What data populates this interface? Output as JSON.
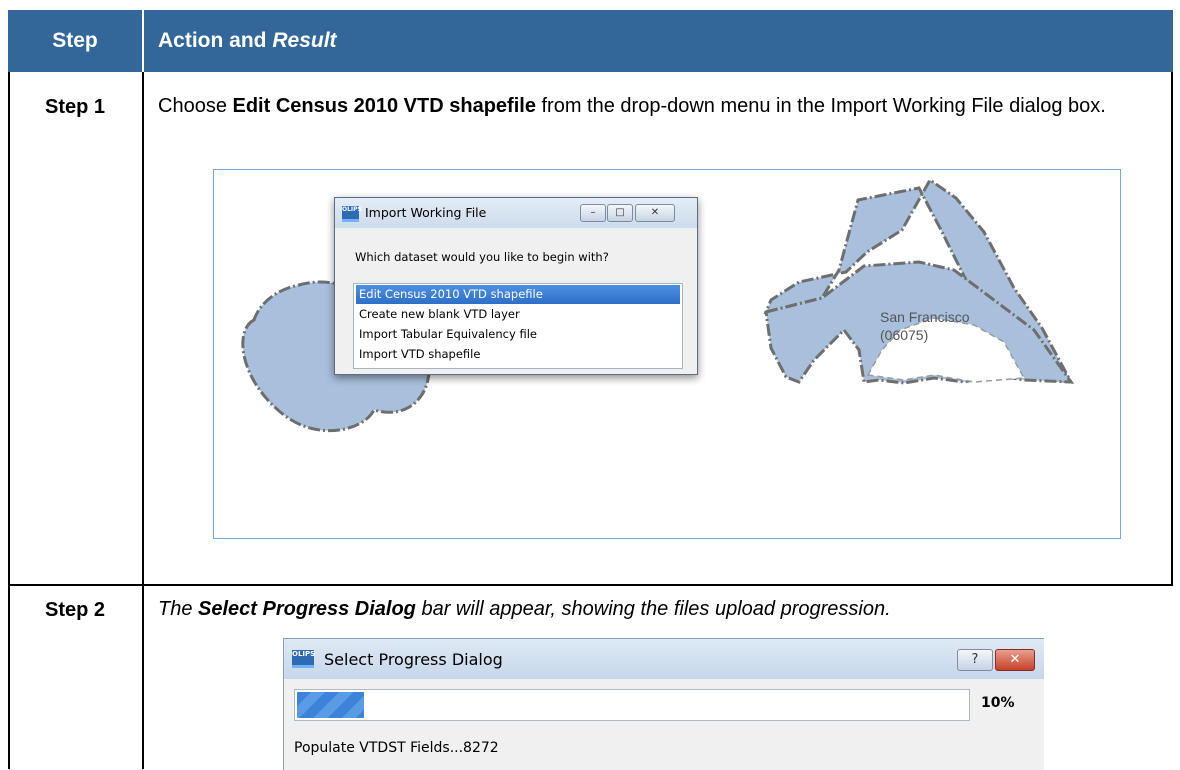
{
  "table": {
    "header": {
      "step": "Step",
      "action_prefix": "Action and ",
      "action_italic": "Result"
    },
    "step1": {
      "label": "Step 1",
      "text_before": "Choose ",
      "text_bold": "Edit Census 2010 VTD shapefile",
      "text_after": " from the drop-down menu in the Import Working File dialog box."
    },
    "step2": {
      "label": "Step 2",
      "text_before": "The ",
      "text_bold": "Select Progress Dialog",
      "text_after": " bar will appear, showing the files upload progression."
    }
  },
  "import_dialog": {
    "app_icon": "OLIPS",
    "title": "Import Working File",
    "question": "Which dataset would you like to begin with?",
    "options": [
      "Edit Census 2010 VTD shapefile",
      "Create new blank VTD layer",
      "Import Tabular Equivalency file",
      "Import VTD shapefile"
    ],
    "selected_index": 0,
    "buttons": {
      "minimize": "–",
      "maximize": "□",
      "close": "✕"
    }
  },
  "map": {
    "label_name": "San Francisco",
    "label_code": "(06075)",
    "fill": "#a9c0dc",
    "stroke": "#6e6e6e"
  },
  "progress_dialog": {
    "app_icon": "OLIPS",
    "title": "Select Progress Dialog",
    "percent_label": "10%",
    "progress": 0.1,
    "status": "Populate VTDST Fields...8272",
    "buttons": {
      "help": "?",
      "close": "✕"
    }
  },
  "colors": {
    "header_bg": "#336699",
    "selection": "#3176cf",
    "progress_fill": "#3d84d8"
  }
}
